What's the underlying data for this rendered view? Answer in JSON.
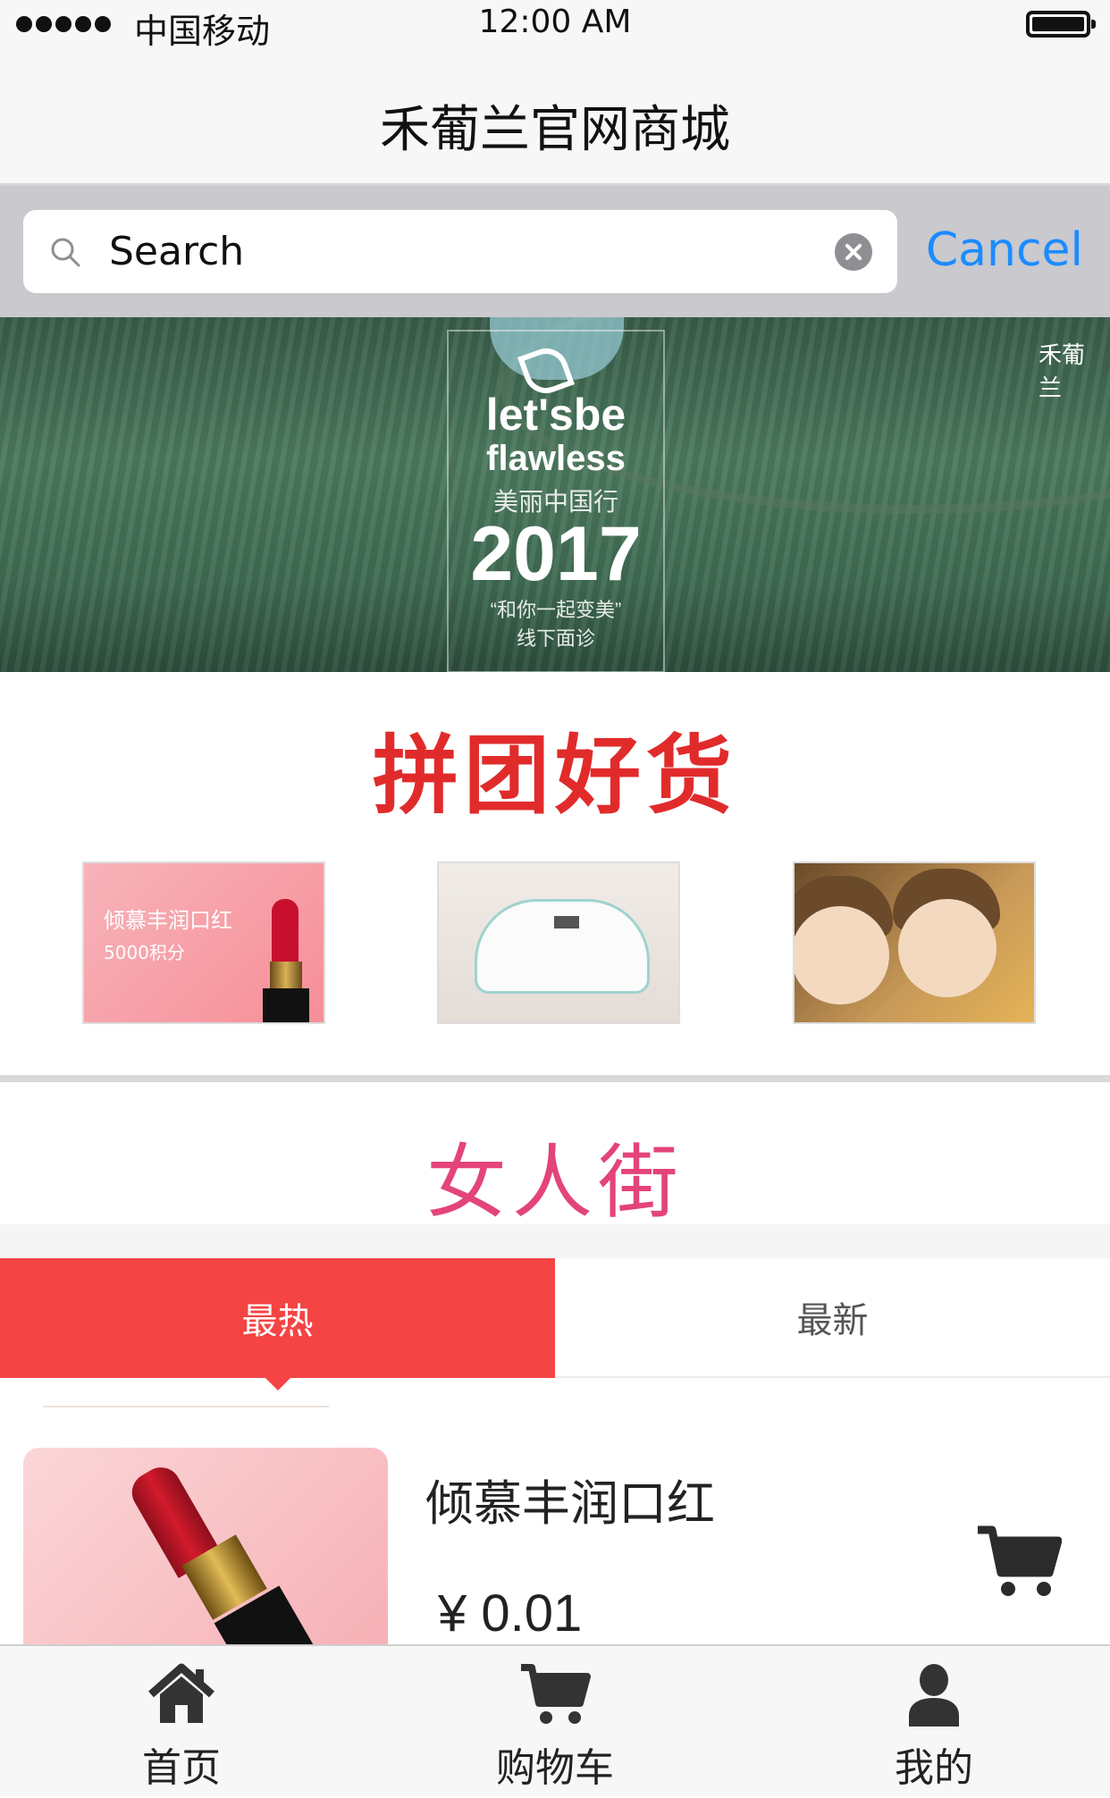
{
  "status_bar": {
    "carrier": "中国移动",
    "time": "12:00 AM"
  },
  "header": {
    "title": "禾葡兰官网商城"
  },
  "search": {
    "placeholder": "Search",
    "value": "Search",
    "cancel_label": "Cancel"
  },
  "banner": {
    "line1": "let'sbe",
    "line2": "flawless",
    "line3": "美丽中国行",
    "line4": "2017",
    "line5": "“和你一起变美”",
    "line6": "线下面诊",
    "brand": "禾葡兰"
  },
  "group_buy": {
    "title": "拼团好货",
    "items": [
      {
        "name": "lipstick-promo",
        "caption_1": "倾慕丰润口红",
        "caption_2": "5000积分"
      },
      {
        "name": "cosmetic-pouch"
      },
      {
        "name": "plush-dolls"
      }
    ]
  },
  "women_street": {
    "title": "女人街"
  },
  "tabs": [
    {
      "label": "最热",
      "active": true
    },
    {
      "label": "最新",
      "active": false
    }
  ],
  "product": {
    "name": "倾慕丰润口红",
    "price": "¥ 0.01"
  },
  "tab_bar": [
    {
      "label": "首页",
      "icon": "home-icon"
    },
    {
      "label": "购物车",
      "icon": "cart-icon"
    },
    {
      "label": "我的",
      "icon": "user-icon"
    }
  ],
  "colors": {
    "accent_red": "#f54444",
    "title_red": "#e12b2b",
    "street_pink": "#e3447a",
    "link_blue": "#1a8cff"
  }
}
